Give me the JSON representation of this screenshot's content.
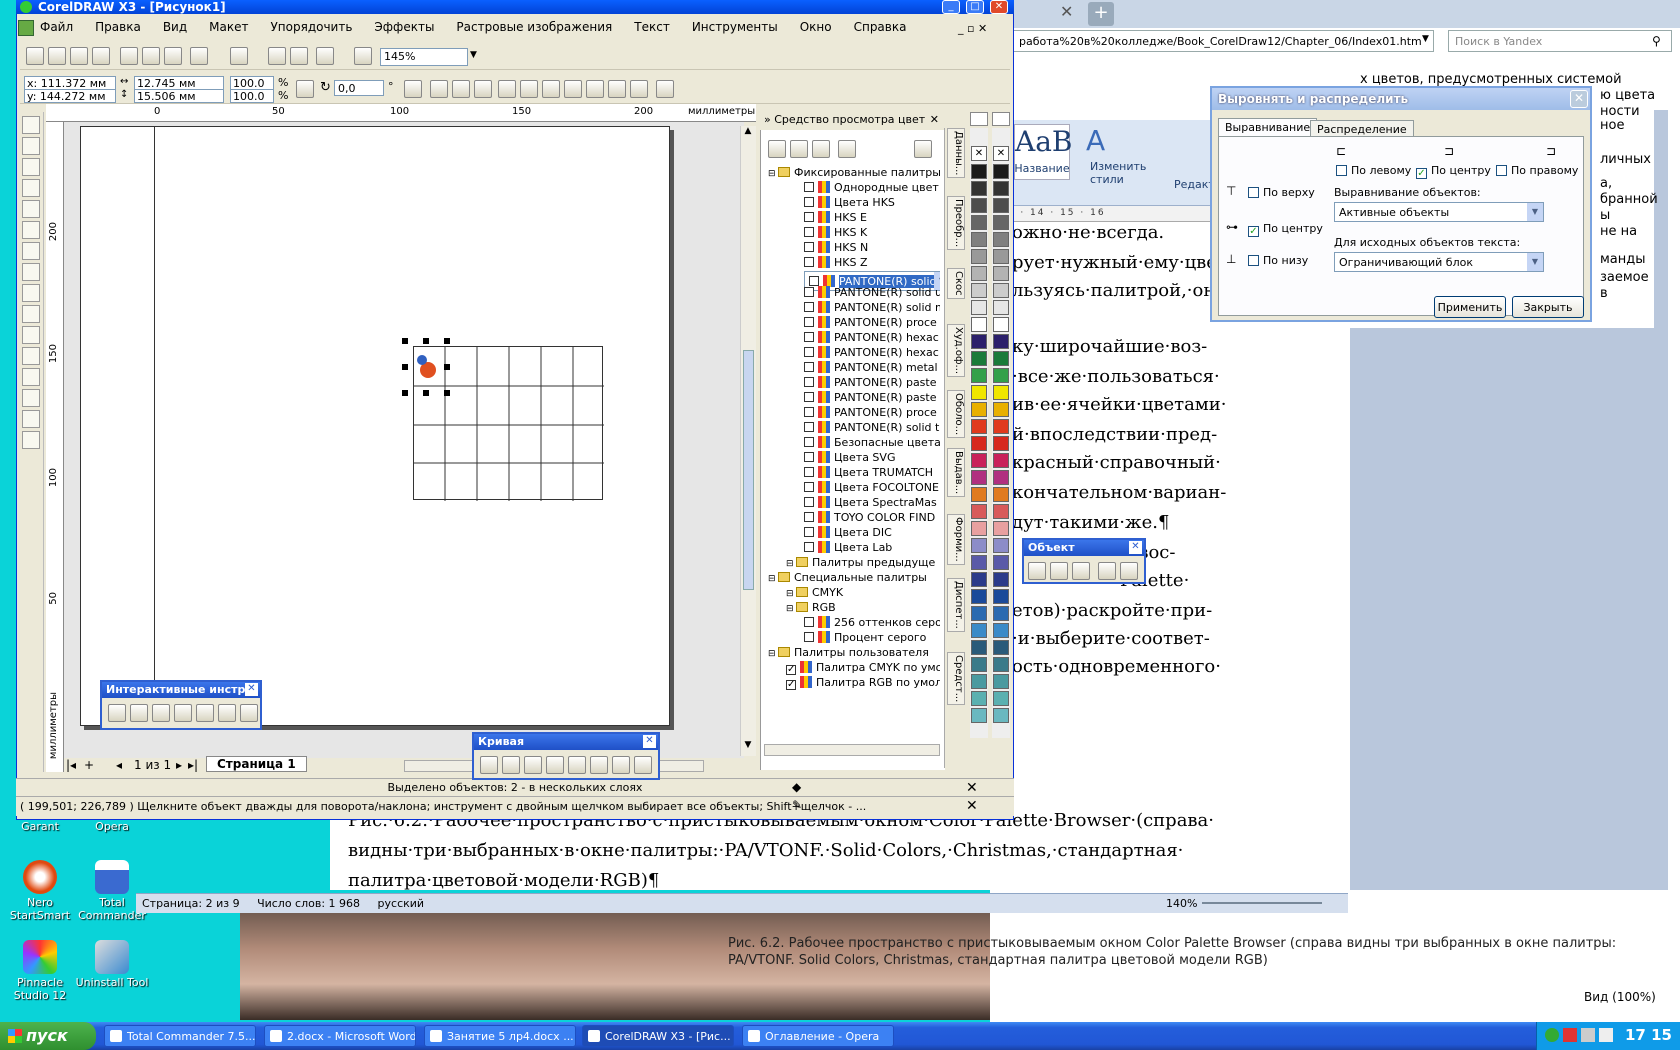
{
  "corel": {
    "title": "CorelDRAW X3 - [Рисунок1]",
    "menu": [
      "Файл",
      "Правка",
      "Вид",
      "Макет",
      "Упорядочить",
      "Эффекты",
      "Растровые изображения",
      "Текст",
      "Инструменты",
      "Окно",
      "Справка"
    ],
    "zoom": "145%",
    "x_pos": "x: 111.372 мм",
    "y_pos": "y: 144.272 мм",
    "width": "12.745 мм",
    "height": "15.506 мм",
    "scale_x": "100.0",
    "scale_y": "100.0",
    "pct": "%",
    "angle": "0,0",
    "deg": "°",
    "ruler_ticks": [
      "0",
      "50",
      "100",
      "150",
      "200"
    ],
    "ruler_unit": "миллиметры",
    "vruler_ticks": [
      "200",
      "150",
      "100",
      "50"
    ],
    "page_counter": "1 из 1",
    "page_tab": "Страница 1",
    "selection_status": "Выделено объектов: 2 - в нескольких слоях",
    "status": "( 199,501; 226,789 )   Щелкните объект дважды для поворота/наклона; инструмент с двойным щелчком выбирает все объекты; Shift+щелчок - ..."
  },
  "docker": {
    "title": "Средство просмотра цвет",
    "tree": [
      {
        "label": "Фиксированные палитры",
        "type": "folder",
        "indent": 0
      },
      {
        "label": "Однородные цвет",
        "type": "item",
        "indent": 2
      },
      {
        "label": "Цвета HKS",
        "type": "item",
        "indent": 2
      },
      {
        "label": "HKS E",
        "type": "item",
        "indent": 2
      },
      {
        "label": "HKS K",
        "type": "item",
        "indent": 2
      },
      {
        "label": "HKS N",
        "type": "item",
        "indent": 2
      },
      {
        "label": "HKS Z",
        "type": "item",
        "indent": 2
      },
      {
        "label": "PANTONE(R) solid c",
        "type": "item",
        "indent": 2,
        "selected": true
      },
      {
        "label": "PANTONE(R) solid u",
        "type": "item",
        "indent": 2
      },
      {
        "label": "PANTONE(R) solid m",
        "type": "item",
        "indent": 2
      },
      {
        "label": "PANTONE(R) proce",
        "type": "item",
        "indent": 2
      },
      {
        "label": "PANTONE(R) hexac",
        "type": "item",
        "indent": 2
      },
      {
        "label": "PANTONE(R) hexac",
        "type": "item",
        "indent": 2
      },
      {
        "label": "PANTONE(R) metal",
        "type": "item",
        "indent": 2
      },
      {
        "label": "PANTONE(R) paste",
        "type": "item",
        "indent": 2
      },
      {
        "label": "PANTONE(R) paste",
        "type": "item",
        "indent": 2
      },
      {
        "label": "PANTONE(R) proce",
        "type": "item",
        "indent": 2
      },
      {
        "label": "PANTONE(R) solid t",
        "type": "item",
        "indent": 2
      },
      {
        "label": "Безопасные цвета",
        "type": "item",
        "indent": 2
      },
      {
        "label": "Цвета SVG",
        "type": "item",
        "indent": 2
      },
      {
        "label": "Цвета TRUMATCH",
        "type": "item",
        "indent": 2
      },
      {
        "label": "Цвета FOCOLTONE",
        "type": "item",
        "indent": 2
      },
      {
        "label": "Цвета SpectraMas",
        "type": "item",
        "indent": 2
      },
      {
        "label": "TOYO COLOR FIND",
        "type": "item",
        "indent": 2
      },
      {
        "label": "Цвета DIC",
        "type": "item",
        "indent": 2
      },
      {
        "label": "Цвета Lab",
        "type": "item",
        "indent": 2
      },
      {
        "label": "Палитры предыдуще",
        "type": "folder",
        "indent": 1
      },
      {
        "label": "Специальные палитры",
        "type": "folder",
        "indent": 0
      },
      {
        "label": "CMYK",
        "type": "folder",
        "indent": 1
      },
      {
        "label": "RGB",
        "type": "folder",
        "indent": 1
      },
      {
        "label": "256 оттенков серо",
        "type": "item",
        "indent": 2
      },
      {
        "label": "Процент серого",
        "type": "item",
        "indent": 2
      },
      {
        "label": "Палитры пользователя",
        "type": "folder",
        "indent": 0
      },
      {
        "label": "Палитра CMYK по умо.",
        "type": "item",
        "indent": 1,
        "checked": true
      },
      {
        "label": "Палитра RGB по умолч",
        "type": "item",
        "indent": 1,
        "checked": true
      }
    ],
    "tabs": [
      "Данны...",
      "Преобр...",
      "Скос",
      "Худ.оф...",
      "Оболо...",
      "Выдав...",
      "Форми...",
      "Диспет...",
      "Средст..."
    ]
  },
  "palette_colors": [
    "#1a1a1a",
    "#333333",
    "#4d4d4d",
    "#666666",
    "#808080",
    "#999999",
    "#b3b3b3",
    "#cccccc",
    "#e6e6e6",
    "#ffffff",
    "#2b1f6b",
    "#1a7a3a",
    "#33a04a",
    "#f0e600",
    "#e8b000",
    "#e03a1e",
    "#d6281e",
    "#c8205a",
    "#b03080",
    "#e07a20",
    "#d85a5a",
    "#e8a0a0",
    "#8c8cc8",
    "#5a5aa8",
    "#2a3a8a",
    "#1a4a9a",
    "#2a6ab0",
    "#3a8ac8",
    "#2a5a7a",
    "#3a7a8a",
    "#4a9aa0",
    "#5ab0b0",
    "#6ab8c0"
  ],
  "float_interactive": {
    "title": "Интерактивные инстр..."
  },
  "float_curve": {
    "title": "Кривая"
  },
  "float_object": {
    "title": "Объект"
  },
  "align": {
    "title": "Выровнять и распределить",
    "tab_align": "Выравнивание",
    "tab_distribute": "Распределение",
    "left": "По левому",
    "center_h": "По центру",
    "right": "По правому",
    "top": "По верху",
    "center_v": "По центру",
    "bottom": "По низу",
    "align_objects_label": "Выравнивание объектов:",
    "align_objects_value": "Активные объекты",
    "text_source_label": "Для исходных объектов текста:",
    "text_source_value": "Ограничивающий блок",
    "apply": "Применить",
    "close": "Закрыть"
  },
  "browser": {
    "address": "работа%20в%20колледже/Book_CorelDraw12/Chapter_06/Index01.htm",
    "search_placeholder": "Поиск в Yandex",
    "caption": "Рис. 6.2. Рабочее пространство с пристыковываемым окном Color Palette Browser (справа видны три выбранных в окне палитры: PA/VTONF. Solid Colors, Christmas, стандартная палитра цветовой модели RGB)",
    "zoom_label": "Вид (100%)",
    "side_text": [
      "х цветов, предусмотренных системой",
      "ю цвета",
      "ности",
      "ное",
      "личных",
      "а,",
      "бранной",
      "ы",
      "не на",
      "манды",
      "заемое",
      "в"
    ]
  },
  "word": {
    "lines": [
      "ожно·не·всегда.",
      "рует·нужный·ему·цвет",
      "льзуясь·палитрой,·он",
      "ку·широчайшие·воз-",
      "·все·же·пользоваться·",
      "ив·ее·ячейки·цветами·",
      "й·впоследствии·пред-",
      "красный·справочный·",
      "кончательном·вариан-",
      "дут·такими·же.¶",
      "ет·вос-",
      "Palette·",
      "етов)·раскройте·при-",
      "·и·выберите·соответ-",
      "ость·одновременного·"
    ],
    "caption1": "Рис.·6.2.·Рабочее·пространство·с·пристыковываемым·окном·Color·Palette·Browser·(справа·",
    "caption2": "видны·три·выбранных·в·окне·палитры:·PA/VTONF.·Solid·Colors,·Christmas,·стандартная·",
    "caption3": "палитра·цветовой·модели·RGB)¶",
    "style_name": "Название",
    "change_styles": "Изменить стили",
    "edit_label": "Редакти",
    "ruler": "13 · 14 · 15 · 16",
    "status_page": "Страница: 2 из 9",
    "status_words": "Число слов: 1 968",
    "status_lang": "русский",
    "zoom": "140%"
  },
  "desktop": {
    "icons": [
      {
        "label": "Garant",
        "color": "#2d6bd1"
      },
      {
        "label": "Opera",
        "color": "#d02020"
      },
      {
        "label": "Nero StartSmart",
        "color": "#e04a10"
      },
      {
        "label": "Total Commander",
        "color": "#3a6ad0"
      },
      {
        "label": "Pinnacle Studio 12",
        "color": "#7a2aa0"
      },
      {
        "label": "Uninstall Tool",
        "color": "#3a8ad0"
      }
    ]
  },
  "taskbar": {
    "start": "пуск",
    "items": [
      "Total Commander 7.5...",
      "2.docx - Microsoft Word",
      "Занятие 5 лр4.docx ...",
      "CorelDRAW X3 - [Рис...",
      "Оглавление - Opera"
    ],
    "active_index": 3,
    "clock": "17 15"
  }
}
